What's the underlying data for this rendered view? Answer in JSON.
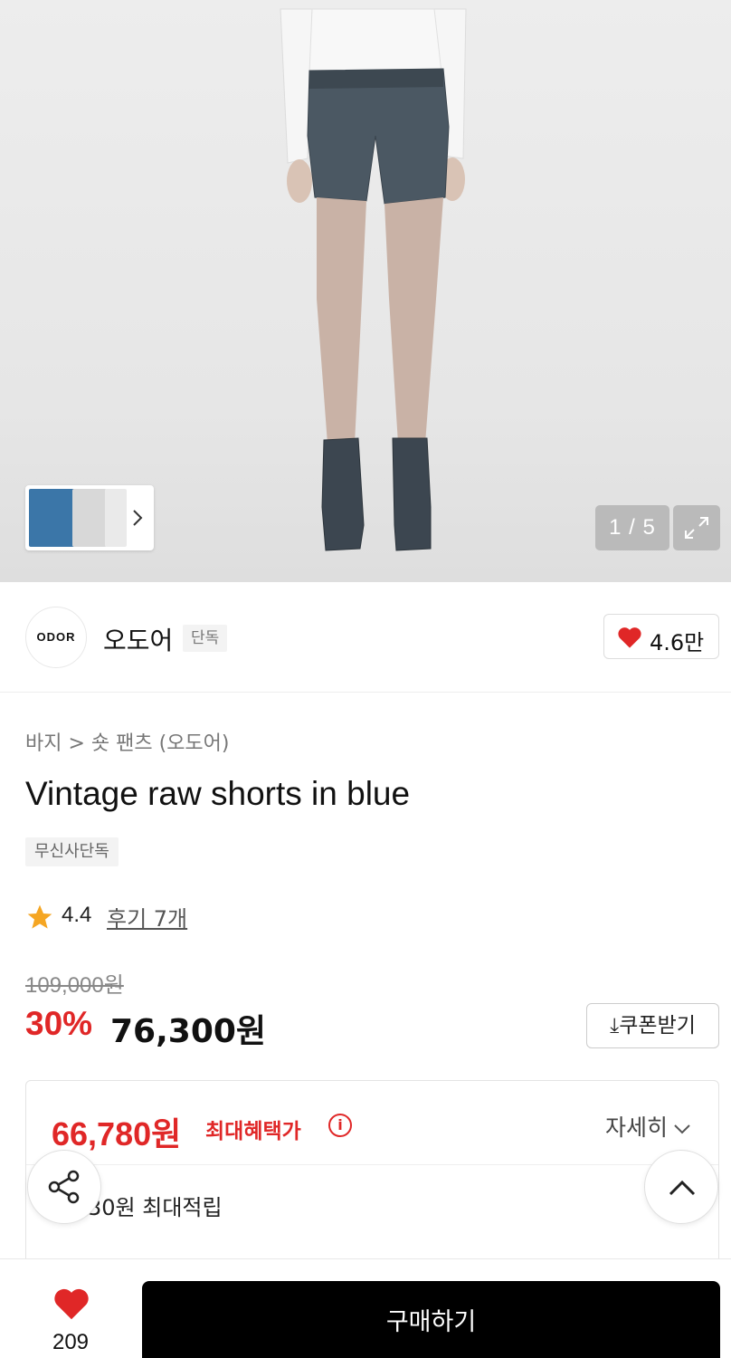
{
  "gallery": {
    "counter": "1 / 5",
    "icons": [
      "chevron-right-icon",
      "expand-icon"
    ]
  },
  "brand": {
    "logo_text": "ODOR",
    "name": "오도어",
    "tag": "단독",
    "likes": "4.6만"
  },
  "product": {
    "breadcrumb": "바지 > 숏 팬츠 (오도어)",
    "title": "Vintage raw shorts in blue",
    "badge": "무신사단독",
    "rating": "4.4",
    "review_link": "후기 7개",
    "original_price": "109,000원",
    "discount": "30%",
    "sale_price": "76,300원",
    "coupon_label": "쿠폰받기"
  },
  "benefit": {
    "max_price": "66,780원",
    "max_label": "최대혜택가",
    "detail_label": "자세히",
    "points": "30원 최대적립"
  },
  "bottom": {
    "wish_count": "209",
    "buy_label": "구매하기"
  },
  "colors": {
    "accent": "#e02727",
    "buy_button": "#000000"
  }
}
